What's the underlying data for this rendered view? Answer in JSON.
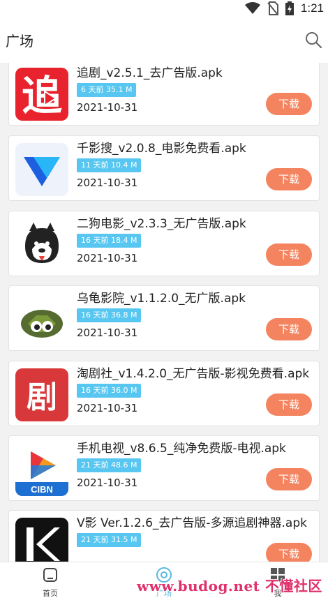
{
  "status_bar": {
    "time": "1:21"
  },
  "header": {
    "title": "广场"
  },
  "apps": [
    {
      "name": "追剧_v2.5.1_去广告版.apk",
      "meta": "6 天前 35.1 M",
      "date": "2021-10-31",
      "download_label": "下载",
      "icon": "zhuiju-icon",
      "icon_text": "追"
    },
    {
      "name": "千影搜_v2.0.8_电影免费看.apk",
      "meta": "11 天前 10.4 M",
      "date": "2021-10-31",
      "download_label": "下载",
      "icon": "qianying-icon"
    },
    {
      "name": "二狗电影_v2.3.3_无广告版.apk",
      "meta": "16 天前 18.4 M",
      "date": "2021-10-31",
      "download_label": "下载",
      "icon": "ergou-dog-icon"
    },
    {
      "name": "乌龟影院_v1.1.2.0_无广版.apk",
      "meta": "16 天前 36.8 M",
      "date": "2021-10-31",
      "download_label": "下载",
      "icon": "turtle-icon"
    },
    {
      "name": "淘剧社_v1.4.2.0_无广告版-影视免费看.apk",
      "meta": "16 天前 36.0 M",
      "date": "2021-10-31",
      "download_label": "下载",
      "icon": "taojushe-icon",
      "icon_text": "剧"
    },
    {
      "name": "手机电视_v8.6.5_纯净免费版-电视.apk",
      "meta": "21 天前 48.6 M",
      "date": "2021-10-31",
      "download_label": "下载",
      "icon": "cibn-icon",
      "icon_text": "CIBN"
    },
    {
      "name": "V影 Ver.1.2.6_去广告版-多源追剧神器.apk",
      "meta": "21 天前 31.5 M",
      "date": "",
      "download_label": "下载",
      "icon": "vying-icon"
    }
  ],
  "tabs": [
    {
      "label": "首页"
    },
    {
      "label": "广场"
    },
    {
      "label": "我"
    }
  ],
  "watermark": "www.budog.net 不懂社区",
  "colors": {
    "accent_download": "#f4845f",
    "meta_badge": "#57c6f0",
    "active_tab": "#57b8e0"
  }
}
